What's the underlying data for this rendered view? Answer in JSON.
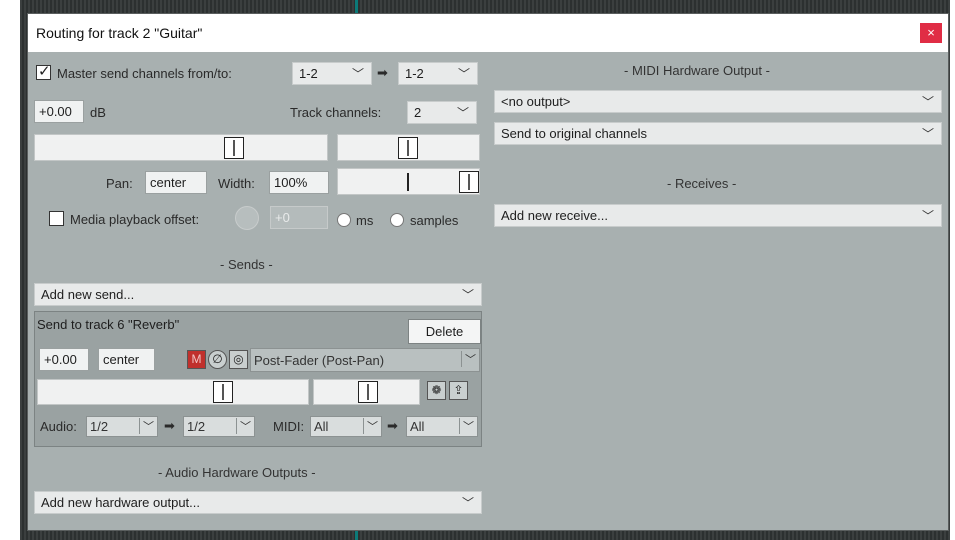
{
  "window": {
    "title": "Routing for track 2 \"Guitar\"",
    "close_glyph": "×"
  },
  "master": {
    "checkbox_checked": true,
    "label": "Master send channels from/to:",
    "from": "1-2",
    "arrow": "➡",
    "to": "1-2"
  },
  "volume": {
    "value": "+0.00",
    "unit": "dB"
  },
  "track_channels": {
    "label": "Track channels:",
    "value": "2"
  },
  "pan": {
    "label": "Pan:",
    "value": "center"
  },
  "width": {
    "label": "Width:",
    "value": "100%"
  },
  "media_offset": {
    "label": "Media playback offset:",
    "value": "+0",
    "ms_label": "ms",
    "samples_label": "samples"
  },
  "sends": {
    "title": "- Sends -",
    "add_label": "Add new send...",
    "send": {
      "name": "Send to track 6 \"Reverb\"",
      "delete_label": "Delete",
      "volume": "+0.00",
      "pan": "center",
      "mute_label": "M",
      "mode": "Post-Fader (Post-Pan)",
      "audio_label": "Audio:",
      "audio_from": "1/2",
      "audio_to": "1/2",
      "midi_label": "MIDI:",
      "midi_from": "All",
      "midi_to": "All",
      "arrow": "➡"
    }
  },
  "audio_hw": {
    "title": "- Audio Hardware Outputs -",
    "add_label": "Add new hardware output..."
  },
  "midi_hw": {
    "title": "- MIDI Hardware Output -",
    "output": "<no output>",
    "channels": "Send to original channels"
  },
  "receives": {
    "title": "- Receives -",
    "add_label": "Add new receive..."
  },
  "colors": {
    "dialog_bg": "#a8b0b0",
    "close_red": "#e02d45",
    "mute_red": "#c0302c"
  }
}
